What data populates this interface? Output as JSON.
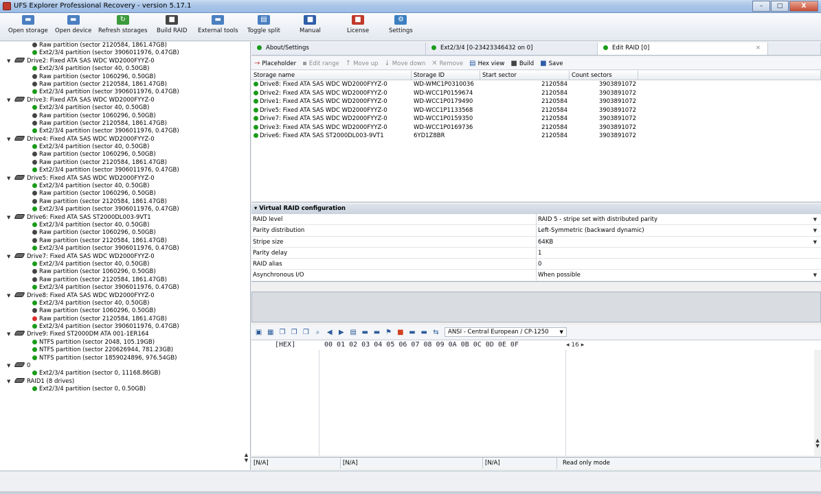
{
  "window": {
    "title": "UFS Explorer Professional Recovery - version 5.17.1",
    "min": "–",
    "max": "□",
    "close": "X"
  },
  "toolbar": [
    {
      "label": "Open storage",
      "icon": "open-storage-icon",
      "glyph": "▬",
      "color": "#4a7fc1"
    },
    {
      "label": "Open device",
      "icon": "open-device-icon",
      "glyph": "▬",
      "color": "#4a7fc1"
    },
    {
      "label": "Refresh storages",
      "icon": "refresh-icon",
      "glyph": "↻",
      "color": "#3c9a3c"
    },
    {
      "label": "Build RAID",
      "icon": "build-raid-icon",
      "glyph": "■",
      "color": "#444"
    },
    {
      "label": "External tools",
      "icon": "external-tools-icon",
      "glyph": "▬",
      "color": "#4a7fc1"
    },
    {
      "label": "Toggle split",
      "icon": "toggle-split-icon",
      "glyph": "▤",
      "color": "#4a7fc1"
    },
    {
      "label": "Manual",
      "icon": "manual-icon",
      "glyph": "■",
      "color": "#2f5ea8"
    },
    {
      "label": "License",
      "icon": "license-icon",
      "glyph": "■",
      "color": "#c0392b"
    },
    {
      "label": "Settings",
      "icon": "settings-icon",
      "glyph": "⚙",
      "color": "#3c7fc1"
    }
  ],
  "tree": [
    {
      "kind": "part",
      "text": "Raw partition (sector 2120584, 1861.47GB)",
      "status": "k"
    },
    {
      "kind": "part",
      "text": "Ext2/3/4 partition (sector 3906011976, 0.47GB)",
      "status": "g"
    },
    {
      "kind": "drive",
      "text": "Drive2: Fixed ATA SAS WDC WD2000FYYZ-0"
    },
    {
      "kind": "part",
      "text": "Ext2/3/4 partition (sector 40, 0.50GB)",
      "status": "g"
    },
    {
      "kind": "part",
      "text": "Raw partition (sector 1060296, 0.50GB)",
      "status": "k"
    },
    {
      "kind": "part",
      "text": "Raw partition (sector 2120584, 1861.47GB)",
      "status": "k"
    },
    {
      "kind": "part",
      "text": "Ext2/3/4 partition (sector 3906011976, 0.47GB)",
      "status": "g"
    },
    {
      "kind": "drive",
      "text": "Drive3: Fixed ATA SAS WDC WD2000FYYZ-0"
    },
    {
      "kind": "part",
      "text": "Ext2/3/4 partition (sector 40, 0.50GB)",
      "status": "g"
    },
    {
      "kind": "part",
      "text": "Raw partition (sector 1060296, 0.50GB)",
      "status": "k"
    },
    {
      "kind": "part",
      "text": "Raw partition (sector 2120584, 1861.47GB)",
      "status": "k"
    },
    {
      "kind": "part",
      "text": "Ext2/3/4 partition (sector 3906011976, 0.47GB)",
      "status": "g"
    },
    {
      "kind": "drive",
      "text": "Drive4: Fixed ATA SAS WDC WD2000FYYZ-0"
    },
    {
      "kind": "part",
      "text": "Ext2/3/4 partition (sector 40, 0.50GB)",
      "status": "g"
    },
    {
      "kind": "part",
      "text": "Raw partition (sector 1060296, 0.50GB)",
      "status": "k"
    },
    {
      "kind": "part",
      "text": "Raw partition (sector 2120584, 1861.47GB)",
      "status": "k"
    },
    {
      "kind": "part",
      "text": "Ext2/3/4 partition (sector 3906011976, 0.47GB)",
      "status": "g"
    },
    {
      "kind": "drive",
      "text": "Drive5: Fixed ATA SAS WDC WD2000FYYZ-0"
    },
    {
      "kind": "part",
      "text": "Ext2/3/4 partition (sector 40, 0.50GB)",
      "status": "g"
    },
    {
      "kind": "part",
      "text": "Raw partition (sector 1060296, 0.50GB)",
      "status": "k"
    },
    {
      "kind": "part",
      "text": "Raw partition (sector 2120584, 1861.47GB)",
      "status": "k"
    },
    {
      "kind": "part",
      "text": "Ext2/3/4 partition (sector 3906011976, 0.47GB)",
      "status": "g"
    },
    {
      "kind": "drive",
      "text": "Drive6: Fixed ATA SAS ST2000DL003-9VT1"
    },
    {
      "kind": "part",
      "text": "Ext2/3/4 partition (sector 40, 0.50GB)",
      "status": "g"
    },
    {
      "kind": "part",
      "text": "Raw partition (sector 1060296, 0.50GB)",
      "status": "k"
    },
    {
      "kind": "part",
      "text": "Raw partition (sector 2120584, 1861.47GB)",
      "status": "k"
    },
    {
      "kind": "part",
      "text": "Ext2/3/4 partition (sector 3906011976, 0.47GB)",
      "status": "g"
    },
    {
      "kind": "drive",
      "text": "Drive7: Fixed ATA SAS WDC WD2000FYYZ-0"
    },
    {
      "kind": "part",
      "text": "Ext2/3/4 partition (sector 40, 0.50GB)",
      "status": "g"
    },
    {
      "kind": "part",
      "text": "Raw partition (sector 1060296, 0.50GB)",
      "status": "k"
    },
    {
      "kind": "part",
      "text": "Raw partition (sector 2120584, 1861.47GB)",
      "status": "k"
    },
    {
      "kind": "part",
      "text": "Ext2/3/4 partition (sector 3906011976, 0.47GB)",
      "status": "g"
    },
    {
      "kind": "drive",
      "text": "Drive8: Fixed ATA SAS WDC WD2000FYYZ-0"
    },
    {
      "kind": "part",
      "text": "Ext2/3/4 partition (sector 40, 0.50GB)",
      "status": "g"
    },
    {
      "kind": "part",
      "text": "Raw partition (sector 1060296, 0.50GB)",
      "status": "k"
    },
    {
      "kind": "part",
      "text": "Raw partition (sector 2120584, 1861.47GB)",
      "status": "r"
    },
    {
      "kind": "part",
      "text": "Ext2/3/4 partition (sector 3906011976, 0.47GB)",
      "status": "g"
    },
    {
      "kind": "drive",
      "text": "Drive9: Fixed ST2000DM ATA 001-1ER164"
    },
    {
      "kind": "part",
      "text": "NTFS partition (sector 2048, 105.19GB)",
      "status": "g"
    },
    {
      "kind": "part",
      "text": "NTFS partition (sector 220626944, 781.23GB)",
      "status": "g"
    },
    {
      "kind": "part",
      "text": "NTFS partition (sector 1859024896, 976.54GB)",
      "status": "g"
    },
    {
      "kind": "drive",
      "text": "0"
    },
    {
      "kind": "part",
      "text": "Ext2/3/4 partition (sector 0, 11168.86GB)",
      "status": "g"
    },
    {
      "kind": "drive",
      "text": "RAID1 (8 drives)"
    },
    {
      "kind": "part",
      "text": "Ext2/3/4 partition (sector 0, 0.50GB)",
      "status": "g"
    }
  ],
  "tabs": [
    {
      "label": "About/Settings",
      "width": 254
    },
    {
      "label": "Ext2/3/4 [0-23423346432 on 0]",
      "width": 250
    },
    {
      "label": "Edit RAID [0]",
      "width": 248,
      "active": true
    },
    {
      "label": "",
      "width": 77
    }
  ],
  "tab_close": "×",
  "subtoolbar": [
    {
      "label": "Placeholder",
      "icon": "placeholder-icon",
      "glyph": "→",
      "color": "#c0392b",
      "enabled": true
    },
    {
      "label": "Edit range",
      "icon": "edit-range-icon",
      "glyph": "▪",
      "color": "#999",
      "enabled": false
    },
    {
      "label": "Move up",
      "icon": "move-up-icon",
      "glyph": "↑",
      "color": "#999",
      "enabled": false
    },
    {
      "label": "Move down",
      "icon": "move-down-icon",
      "glyph": "↓",
      "color": "#999",
      "enabled": false
    },
    {
      "label": "Remove",
      "icon": "remove-icon",
      "glyph": "✕",
      "color": "#999",
      "enabled": false
    },
    {
      "label": "Hex view",
      "icon": "hex-view-icon",
      "glyph": "▤",
      "color": "#2f5ea8",
      "enabled": true
    },
    {
      "label": "Build",
      "icon": "build-icon",
      "glyph": "■",
      "color": "#444",
      "enabled": true
    },
    {
      "label": "Save",
      "icon": "save-icon",
      "glyph": "■",
      "color": "#2f5ea8",
      "enabled": true
    }
  ],
  "grid": {
    "headers": [
      "Storage name",
      "Storage ID",
      "Start sector",
      "Count sectors",
      ""
    ],
    "rows": [
      [
        "Drive8: Fixed ATA SAS WDC WD2000FYYZ-0",
        "WD-WMC1P0310036",
        "2120584",
        "3903891072"
      ],
      [
        "Drive2: Fixed ATA SAS WDC WD2000FYYZ-0",
        "WD-WCC1P0159674",
        "2120584",
        "3903891072"
      ],
      [
        "Drive1: Fixed ATA SAS WDC WD2000FYYZ-0",
        "WD-WCC1P0179490",
        "2120584",
        "3903891072"
      ],
      [
        "Drive5: Fixed ATA SAS WDC WD2000FYYZ-0",
        "WD-WCC1P1133568",
        "2120584",
        "3903891072"
      ],
      [
        "Drive7: Fixed ATA SAS WDC WD2000FYYZ-0",
        "WD-WCC1P0159350",
        "2120584",
        "3903891072"
      ],
      [
        "Drive3: Fixed ATA SAS WDC WD2000FYYZ-0",
        "WD-WCC1P0169736",
        "2120584",
        "3903891072"
      ],
      [
        "Drive6: Fixed ATA SAS ST2000DL003-9VT1",
        "6YD1Z8BR",
        "2120584",
        "3903891072"
      ]
    ]
  },
  "config": {
    "title": "Virtual RAID configuration",
    "rows": [
      {
        "label": "RAID level",
        "value": "RAID 5 - stripe set with distributed parity",
        "dropdown": true
      },
      {
        "label": "Parity distribution",
        "value": "Left-Symmetric (backward dynamic)",
        "dropdown": true
      },
      {
        "label": "Stripe size",
        "value": "64KB",
        "dropdown": true
      },
      {
        "label": "Parity delay",
        "value": "1",
        "dropdown": false
      },
      {
        "label": "RAID alias",
        "value": "0",
        "dropdown": false
      },
      {
        "label": "Asynchronous I/O",
        "value": "When possible",
        "dropdown": true
      }
    ]
  },
  "hex": {
    "tools": [
      "save-icon",
      "table-icon",
      "copy-icon",
      "paste-icon",
      "page-icon",
      "find-icon",
      "back-icon",
      "forward-icon",
      "goto-icon",
      "bookmark-icon",
      "bookmark2-icon",
      "flag-icon",
      "red-mark-icon",
      "compare-icon",
      "compare2-icon",
      "sync-icon"
    ],
    "encoding": "ANSI - Central European / CP-1250",
    "header_label": "[HEX]",
    "header_cols": "00 01 02 03 04 05 06 07 08 09 0A 0B 0C 0D 0E 0F",
    "width_label": "◂ 16 ▸"
  },
  "status": [
    "[N/A]",
    "[N/A]",
    "[N/A]",
    "Read only mode"
  ]
}
